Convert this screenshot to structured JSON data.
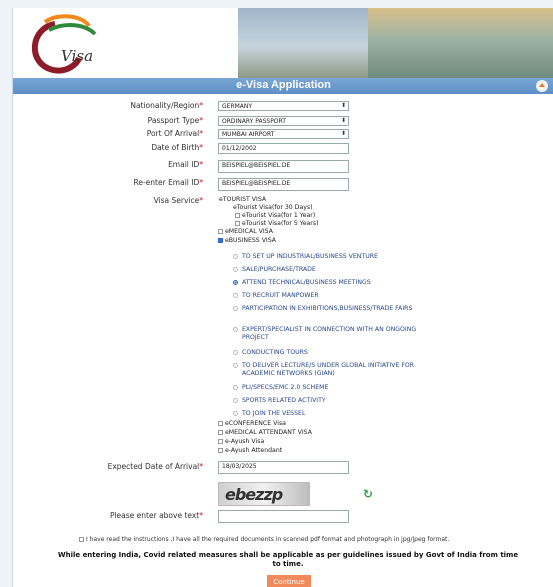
{
  "header": {
    "logo_text": "Visa",
    "title": "e-Visa Application"
  },
  "form": {
    "nationality": {
      "label": "Nationality/Region",
      "value": "GERMANY"
    },
    "passport_type": {
      "label": "Passport Type",
      "value": "ORDINARY PASSPORT"
    },
    "port_of_arrival": {
      "label": "Port Of Arrival",
      "value": "MUMBAI AIRPORT"
    },
    "dob": {
      "label": "Date of Birth",
      "value": "01/12/2002"
    },
    "email": {
      "label": "Email ID",
      "value": "BEISPIEL@BEISPIEL.DE"
    },
    "email_confirm": {
      "label": "Re-enter Email ID",
      "value": "BEISPIEL@BEISPIEL.DE"
    },
    "visa_service_label": "Visa Service",
    "etourist": {
      "label": "eTOURIST VISA",
      "options": [
        "eTourist Visa(for 30 Days)",
        "eTourist Visa(for 1 Year)",
        "eTourist Visa(for 5 Years)"
      ]
    },
    "emedical": "eMEDICAL VISA",
    "ebusiness": {
      "label": "eBUSINESS VISA",
      "options": [
        "TO SET UP INDUSTRIAL/BUSINESS VENTURE",
        "SALE/PURCHASE/TRADE",
        "ATTEND TECHNICAL/BUSINESS MEETINGS",
        "TO RECRUIT MANPOWER",
        "PARTICIPATION IN EXHIBITIONS,BUSINESS/TRADE FAIRS",
        "EXPERT/SPECIALIST IN CONNECTION WITH AN ONGOING PROJECT",
        "CONDUCTING TOURS",
        "TO DELIVER LECTURE/S UNDER GLOBAL INITIATIVE FOR ACADEMIC NETWORKS (GIAN)",
        "PLI/SPECS/EMC 2.0 SCHEME",
        "SPORTS RELATED ACTIVITY",
        "TO JOIN THE VESSEL"
      ],
      "selected_index": 2
    },
    "others": [
      "eCONFERENCE Visa",
      "eMEDICAL ATTENDANT VISA",
      "e-Ayush Visa",
      "e-Ayush Attendant"
    ],
    "arrival": {
      "label": "Expected Date of Arrival",
      "value": "18/03/2025"
    },
    "captcha_text": "ebezzp",
    "captcha_label": "Please enter above text",
    "captcha_value": "",
    "declaration": "I have read the instructions ,I have all the required documents in scanned pdf format and photograph in jpg/jpeg format.",
    "covid_notice": "While entering India, Covid related measures shall be applicable as per guidelines issued by Govt of India from time to time.",
    "continue_label": "Continue",
    "required_mark": "*"
  },
  "colors": {
    "titlebar": "#5d8fc6",
    "accent_option": "#28478c",
    "button": "#f08a5d",
    "required": "#dd0000"
  }
}
